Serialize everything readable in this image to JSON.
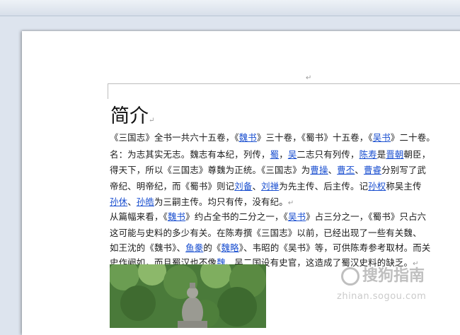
{
  "document": {
    "title": "简介",
    "pilcrow": "↵",
    "lines": [
      [
        {
          "t": "《三国志》全书一共六十五卷，《"
        },
        {
          "t": "魏书",
          "link": true
        },
        {
          "t": "》三十卷，《蜀书》十五卷，《"
        },
        {
          "t": "吴书",
          "link": true
        },
        {
          "t": "》二十卷。"
        }
      ],
      [
        {
          "t": "名：为志其实无志。魏志有本纪，列传，"
        },
        {
          "t": "蜀",
          "link": true
        },
        {
          "t": "，"
        },
        {
          "t": "吴",
          "link": true
        },
        {
          "t": "二志只有列传，"
        },
        {
          "t": "陈寿",
          "link": true
        },
        {
          "t": "是"
        },
        {
          "t": "晋朝",
          "link": true
        },
        {
          "t": "朝臣，"
        }
      ],
      [
        {
          "t": "得天下，所以《三国志》尊魏为正统。《三国志》为"
        },
        {
          "t": "曹操",
          "link": true
        },
        {
          "t": "、"
        },
        {
          "t": "曹丕",
          "link": true
        },
        {
          "t": "、"
        },
        {
          "t": "曹睿",
          "link": true
        },
        {
          "t": "分别写了武"
        }
      ],
      [
        {
          "t": "帝纪、明帝纪，而《蜀书》则记"
        },
        {
          "t": "刘备",
          "link": true
        },
        {
          "t": "、"
        },
        {
          "t": "刘禅",
          "link": true
        },
        {
          "t": "为先主传、后主传。记"
        },
        {
          "t": "孙权",
          "link": true
        },
        {
          "t": "称吴主传"
        }
      ],
      [
        {
          "t": "孙休",
          "link": true
        },
        {
          "t": "、"
        },
        {
          "t": "孙皓",
          "link": true
        },
        {
          "t": "为三嗣主传。均只有传，没有纪。"
        },
        {
          "t": "↵",
          "mark": true
        }
      ],
      [
        {
          "t": "从篇幅来看，《"
        },
        {
          "t": "魏书",
          "link": true
        },
        {
          "t": "》约占全书的二分之一，《"
        },
        {
          "t": "吴书",
          "link": true
        },
        {
          "t": "》占三分之一，《蜀书》只占六"
        }
      ],
      [
        {
          "t": "这可能与史料的多少有关。在陈寿撰《三国志》以前，已经出现了一些有关魏、"
        }
      ],
      [
        {
          "t": "如王沈的《魏书》、"
        },
        {
          "t": "鱼豢",
          "link": true
        },
        {
          "t": "的《"
        },
        {
          "t": "魏略",
          "link": true
        },
        {
          "t": "》、韦昭的《吴书》等，可供陈寿参考取材。而关"
        }
      ],
      [
        {
          "t": "史作阙如，而且蜀汉也不像"
        },
        {
          "t": "魏",
          "link": true
        },
        {
          "t": "、吴二国设有史官，这造成了蜀汉史料的缺乏。"
        },
        {
          "t": "↵",
          "mark": true
        }
      ]
    ]
  },
  "watermark": {
    "main": "搜狗指南",
    "sub": "zhinan.sogou.com"
  }
}
